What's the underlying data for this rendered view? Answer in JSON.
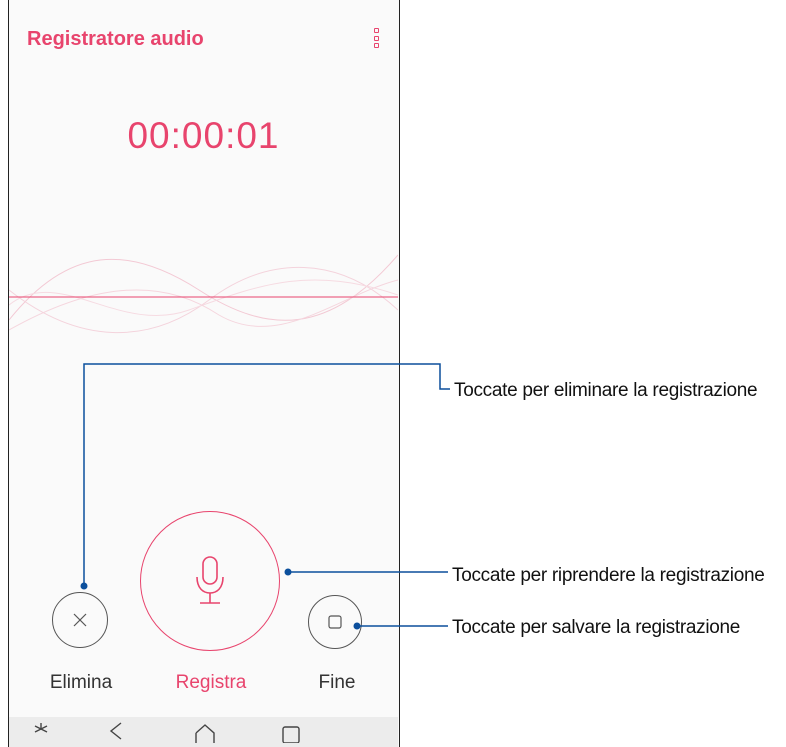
{
  "app": {
    "title": "Registratore audio",
    "timer": "00:00:01",
    "accent_color": "#e8446d"
  },
  "controls": {
    "delete_label": "Elimina",
    "record_label": "Registra",
    "stop_label": "Fine"
  },
  "navbar": {
    "icons": [
      "assistant-icon",
      "back-icon",
      "home-icon",
      "recent-apps-icon"
    ]
  },
  "callouts": {
    "delete": "Toccate per eliminare la registrazione",
    "record": "Toccate per riprendere la registrazione",
    "save": "Toccate per salvare la registrazione",
    "line_color": "#0b4f9c"
  }
}
